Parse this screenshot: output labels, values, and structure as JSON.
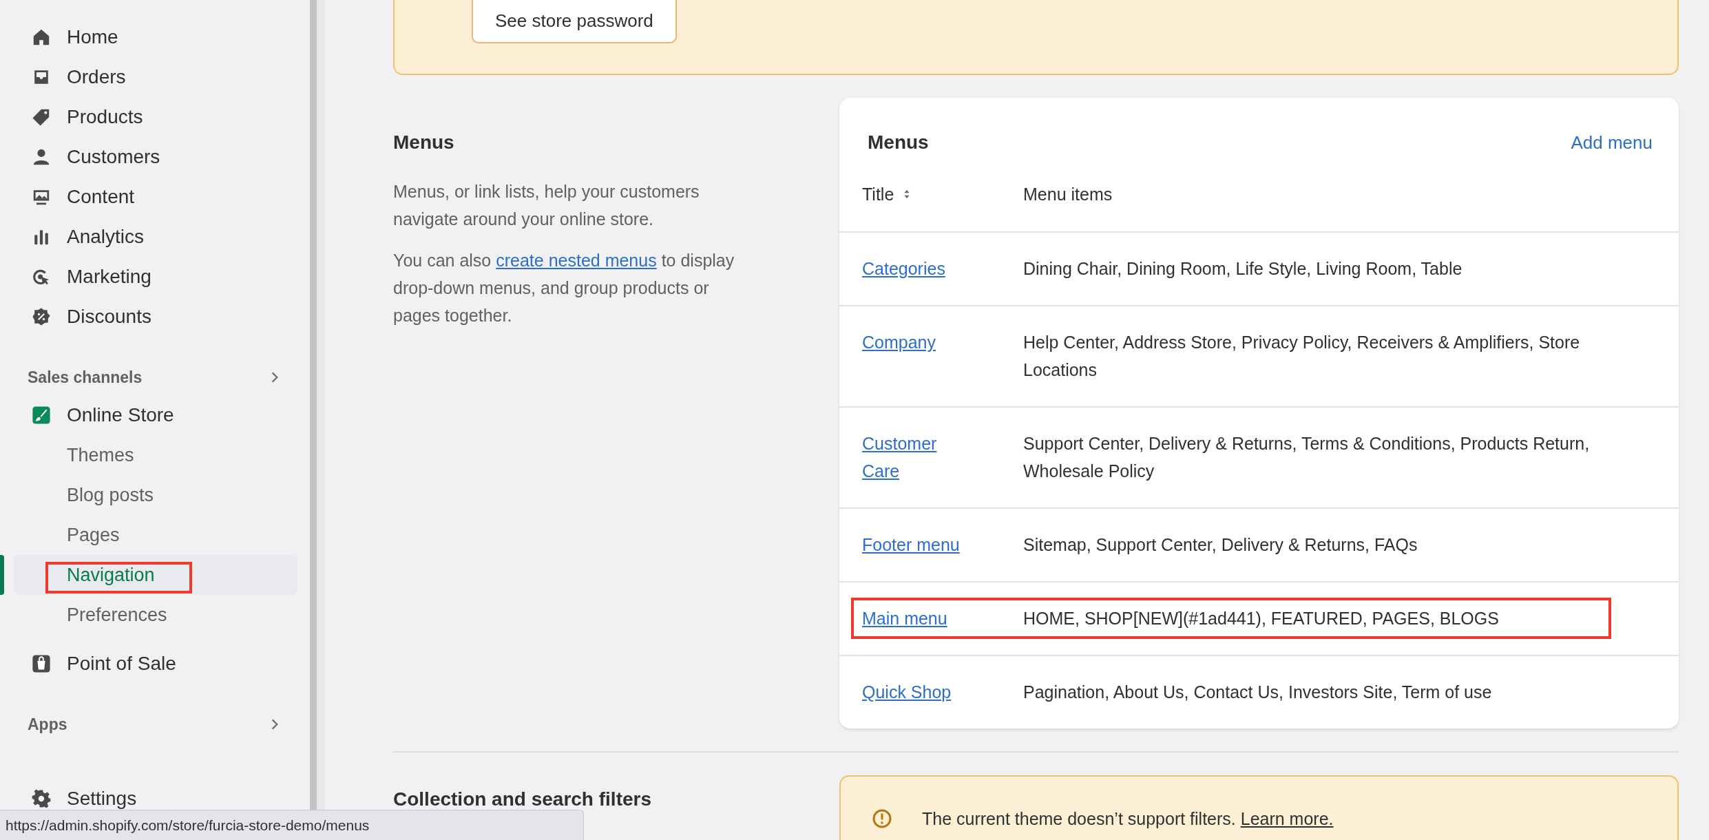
{
  "sidebar": {
    "items": [
      {
        "label": "Home"
      },
      {
        "label": "Orders"
      },
      {
        "label": "Products"
      },
      {
        "label": "Customers"
      },
      {
        "label": "Content"
      },
      {
        "label": "Analytics"
      },
      {
        "label": "Marketing"
      },
      {
        "label": "Discounts"
      }
    ],
    "sales_channels": {
      "label": "Sales channels",
      "channels": [
        {
          "label": "Online Store",
          "children": [
            {
              "label": "Themes",
              "selected": false,
              "highlighted": false
            },
            {
              "label": "Blog posts",
              "selected": false,
              "highlighted": false
            },
            {
              "label": "Pages",
              "selected": false,
              "highlighted": false
            },
            {
              "label": "Navigation",
              "selected": true,
              "highlighted": true
            },
            {
              "label": "Preferences",
              "selected": false,
              "highlighted": false
            }
          ]
        },
        {
          "label": "Point of Sale"
        }
      ]
    },
    "apps": {
      "label": "Apps"
    },
    "settings": {
      "label": "Settings"
    }
  },
  "store_password_banner": {
    "button": "See store password"
  },
  "menus_section": {
    "title": "Menus",
    "description": "Menus, or link lists, help your customers navigate around your online store.",
    "note_before": "You can also ",
    "note_link": "create nested menus",
    "note_after": " to display drop-down menus, and group products or pages together."
  },
  "menus_card": {
    "title": "Menus",
    "add_button": "Add menu",
    "columns": [
      "Title",
      "Menu items"
    ],
    "rows": [
      {
        "title": "Categories",
        "items": "Dining Chair, Dining Room, Life Style, Living Room, Table",
        "highlighted": false
      },
      {
        "title": "Company",
        "items": "Help Center, Address Store, Privacy Policy, Receivers & Amplifiers, Store Locations",
        "highlighted": false
      },
      {
        "title": "Customer Care",
        "items": "Support Center, Delivery & Returns, Terms & Conditions, Products Return, Wholesale Policy",
        "highlighted": false
      },
      {
        "title": "Footer menu",
        "items": "Sitemap, Support Center, Delivery & Returns, FAQs",
        "highlighted": false
      },
      {
        "title": "Main menu",
        "items": "HOME, SHOP[NEW](#1ad441), FEATURED, PAGES, BLOGS",
        "highlighted": true
      },
      {
        "title": "Quick Shop",
        "items": "Pagination, About Us, Contact Us, Investors Site, Term of use",
        "highlighted": false
      }
    ]
  },
  "filters_section": {
    "title": "Collection and search filters",
    "notice": "The current theme doesn’t support filters.",
    "link": "Learn more."
  },
  "status_url": "https://admin.shopify.com/store/furcia-store-demo/menus"
}
